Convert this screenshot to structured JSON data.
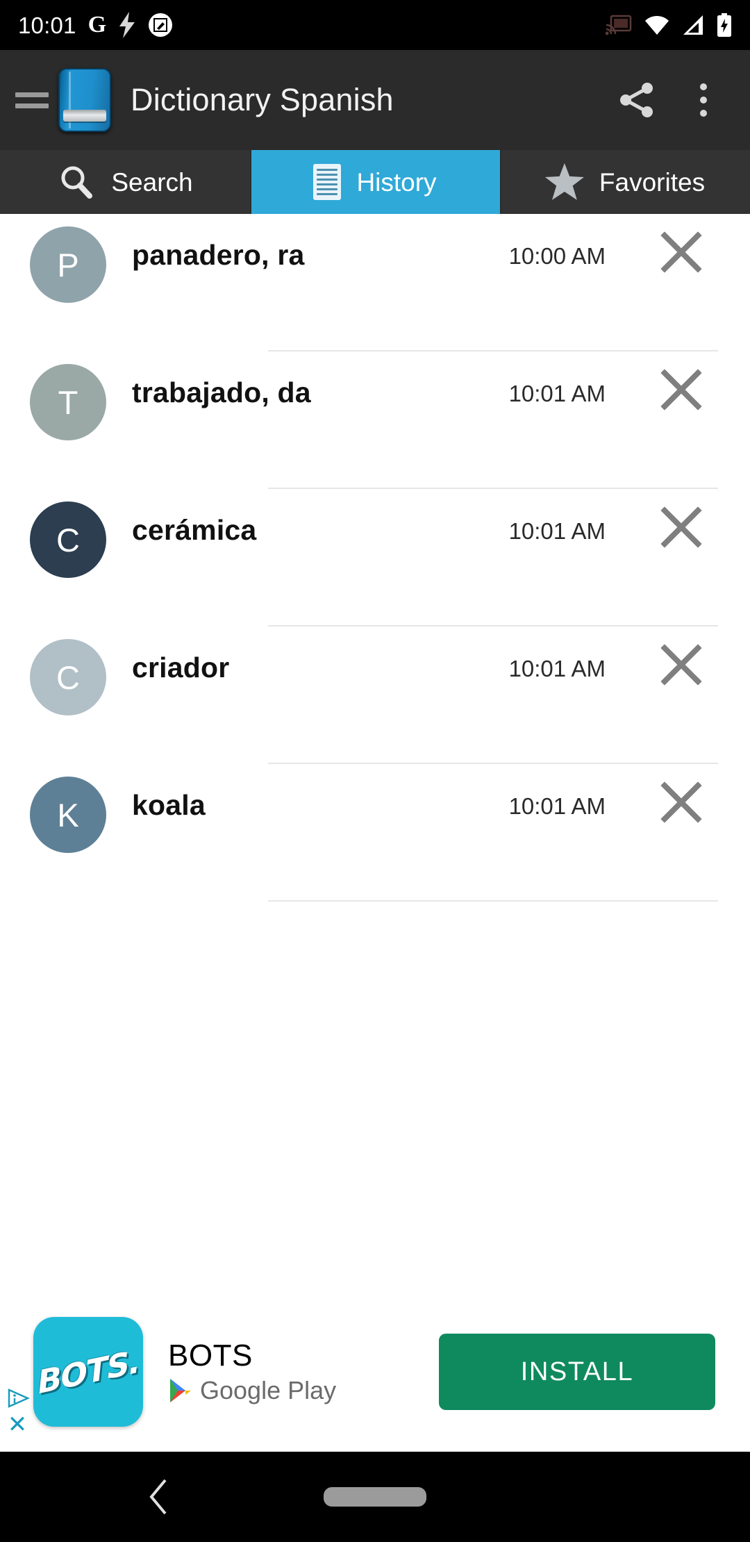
{
  "status_bar": {
    "time": "10:01",
    "left_icons": [
      "google-g-icon",
      "lightning-bolt-icon",
      "screenshot-edit-icon"
    ],
    "right_icons": [
      "cast-icon",
      "wifi-icon",
      "cellular-signal-icon",
      "battery-charging-icon"
    ],
    "background": "#000000"
  },
  "app_bar": {
    "title": "Dictionary Spanish",
    "menu_icon": "hamburger-menu-icon",
    "app_icon": "blue-book-icon",
    "share_icon": "share-icon",
    "overflow_icon": "more-vertical-icon",
    "background": "#2b2b2b",
    "title_color": "#f2f2f2"
  },
  "tabs": {
    "active_index": 1,
    "active_color": "#2fa9d7",
    "inactive_color": "#333333",
    "items": [
      {
        "label": "Search",
        "icon": "search-icon",
        "active": false
      },
      {
        "label": "History",
        "icon": "history-list-icon",
        "active": true
      },
      {
        "label": "Favorites",
        "icon": "star-icon",
        "active": false
      }
    ]
  },
  "history": {
    "items": [
      {
        "initial": "P",
        "word": "panadero, ra",
        "time": "10:00 AM",
        "avatar_color": "#8fa3ab",
        "delete_icon": "close-x-icon"
      },
      {
        "initial": "T",
        "word": "trabajado, da",
        "time": "10:01 AM",
        "avatar_color": "#9aa9a6",
        "delete_icon": "close-x-icon"
      },
      {
        "initial": "C",
        "word": "cerámica",
        "time": "10:01 AM",
        "avatar_color": "#2c3e50",
        "delete_icon": "close-x-icon"
      },
      {
        "initial": "C",
        "word": "criador",
        "time": "10:01 AM",
        "avatar_color": "#b1bfc7",
        "delete_icon": "close-x-icon"
      },
      {
        "initial": "K",
        "word": "koala",
        "time": "10:01 AM",
        "avatar_color": "#5e8096",
        "delete_icon": "close-x-icon"
      }
    ]
  },
  "ad": {
    "app_logo_text": "BOTS.",
    "title": "BOTS",
    "store": "Google Play",
    "store_icon": "google-play-icon",
    "install_label": "INSTALL",
    "install_color": "#0f8a5f",
    "icon_background": "#1fbcd8",
    "adchoices_icon": "adchoices-icon",
    "close_label": "✕"
  },
  "nav_bar": {
    "back_icon": "back-chevron-icon",
    "home_icon": "home-pill-icon",
    "background": "#000000"
  }
}
